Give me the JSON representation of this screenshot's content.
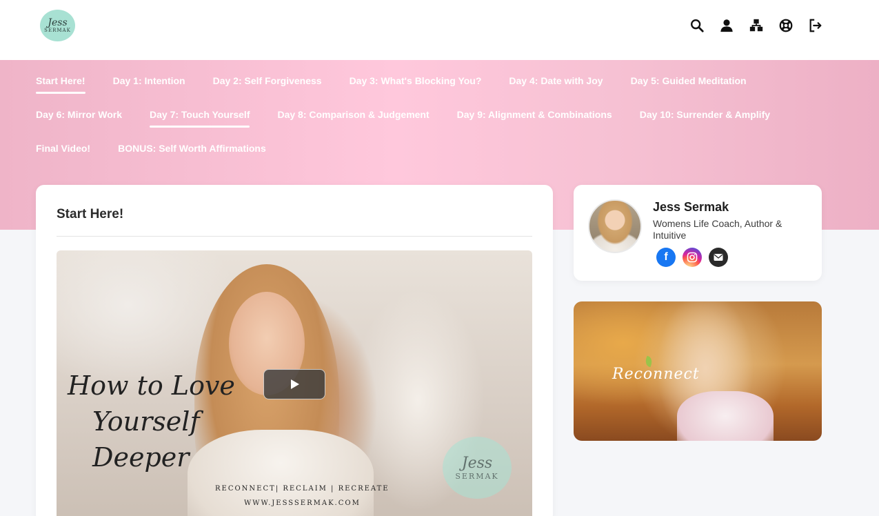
{
  "header": {
    "logo_line1": "Jess",
    "logo_line2": "SERMAK",
    "icons": [
      "search-icon",
      "user-icon",
      "sitemap-icon",
      "help-icon",
      "logout-icon"
    ]
  },
  "nav": {
    "rows": [
      [
        "Start Here!",
        "Day 1: Intention",
        "Day 2: Self Forgiveness",
        "Day 3: What's Blocking You?",
        "Day 4: Date with Joy",
        "Day 5: Guided Meditation"
      ],
      [
        "Day 6: Mirror Work",
        "Day 7: Touch Yourself",
        "Day 8: Comparison & Judgement",
        "Day 9: Alignment & Combinations",
        "Day 10: Surrender & Amplify"
      ],
      [
        "Final Video!",
        "BONUS: Self Worth Affirmations"
      ]
    ],
    "active": [
      "Start Here!",
      "Day 7: Touch Yourself"
    ]
  },
  "main": {
    "title": "Start Here!",
    "video": {
      "script_line1": "How to Love",
      "script_line2": "Yourself",
      "script_line3": "Deeper",
      "tagline": "RECONNECT| RECLAIM | RECREATE",
      "url": "WWW.JESSSERMAK.COM",
      "badge_line1": "Jess",
      "badge_line2": "SERMAK"
    }
  },
  "profile": {
    "name": "Jess Sermak",
    "description": "Womens Life Coach, Author & Intuitive",
    "socials": [
      "facebook-icon",
      "instagram-icon",
      "email-icon"
    ],
    "facebook_glyph": "f"
  },
  "promo": {
    "text": "Reconnect"
  },
  "colors": {
    "band_pink": "#ffc8dc",
    "logo_mint": "#a8e1d3",
    "facebook_blue": "#1877f2"
  }
}
